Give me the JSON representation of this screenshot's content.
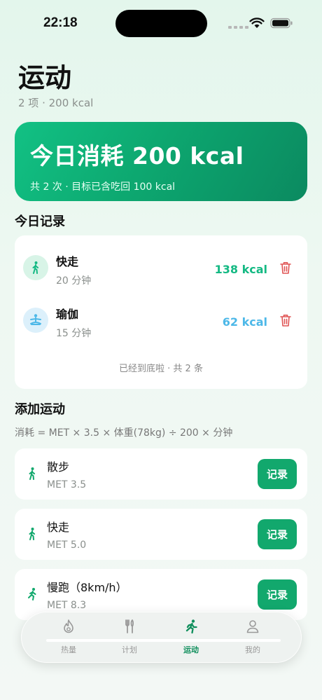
{
  "status": {
    "time": "22:18"
  },
  "header": {
    "title": "运动",
    "subtitle": "2 项 · 200 kcal"
  },
  "hero": {
    "title": "今日消耗 200 kcal",
    "subtitle": "共 2 次 · 目标已含吃回 100 kcal"
  },
  "records": {
    "section_title": "今日记录",
    "items": [
      {
        "name": "快走",
        "duration": "20 分钟",
        "kcal": "138 kcal",
        "icon": "walk-icon",
        "color": "#14b983"
      },
      {
        "name": "瑜伽",
        "duration": "15 分钟",
        "kcal": "62 kcal",
        "icon": "yoga-icon",
        "color": "#4db8e8"
      }
    ],
    "end_text": "已经到底啦 · 共 2 条"
  },
  "add": {
    "section_title": "添加运动",
    "formula": "消耗 = MET × 3.5 × 体重(78kg) ÷ 200 × 分钟",
    "items": [
      {
        "name": "散步",
        "met": "MET 3.5",
        "button": "记录"
      },
      {
        "name": "快走",
        "met": "MET 5.0",
        "button": "记录"
      },
      {
        "name": "慢跑（8km/h）",
        "met": "MET 8.3",
        "button": "记录"
      }
    ]
  },
  "tabs": [
    {
      "label": "热量",
      "icon": "flame-icon",
      "active": false
    },
    {
      "label": "计划",
      "icon": "fork-knife-icon",
      "active": false
    },
    {
      "label": "运动",
      "icon": "running-icon",
      "active": true
    },
    {
      "label": "我的",
      "icon": "person-icon",
      "active": false
    }
  ],
  "colors": {
    "accent": "#12a86d",
    "delete": "#e05555",
    "hero_start": "#12c184",
    "hero_end": "#0b8a60"
  }
}
